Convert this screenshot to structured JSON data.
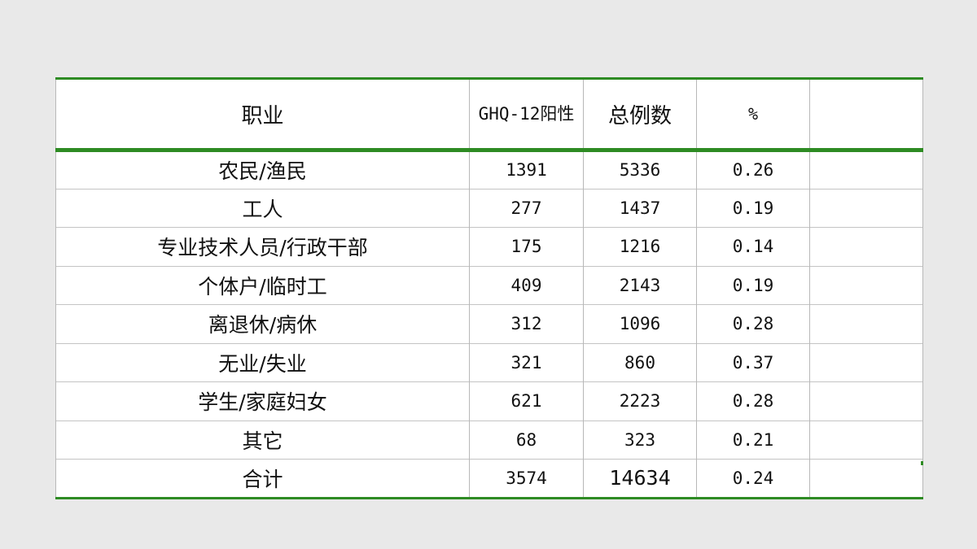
{
  "table": {
    "headers": {
      "occupation": "职业",
      "ghq_positive": "GHQ-12阳性",
      "total_cases": "总例数",
      "percent": "%",
      "extra": ""
    },
    "rows": [
      {
        "occupation": "农民/渔民",
        "ghq_positive": "1391",
        "total_cases": "5336",
        "percent": "0.26",
        "extra": ""
      },
      {
        "occupation": "工人",
        "ghq_positive": "277",
        "total_cases": "1437",
        "percent": "0.19",
        "extra": ""
      },
      {
        "occupation": "专业技术人员/行政干部",
        "ghq_positive": "175",
        "total_cases": "1216",
        "percent": "0.14",
        "extra": ""
      },
      {
        "occupation": "个体户/临时工",
        "ghq_positive": "409",
        "total_cases": "2143",
        "percent": "0.19",
        "extra": ""
      },
      {
        "occupation": "离退休/病休",
        "ghq_positive": "312",
        "total_cases": "1096",
        "percent": "0.28",
        "extra": ""
      },
      {
        "occupation": "无业/失业",
        "ghq_positive": "321",
        "total_cases": "860",
        "percent": "0.37",
        "extra": ""
      },
      {
        "occupation": "学生/家庭妇女",
        "ghq_positive": "621",
        "total_cases": "2223",
        "percent": "0.28",
        "extra": ""
      },
      {
        "occupation": "其它",
        "ghq_positive": "68",
        "total_cases": "323",
        "percent": "0.21",
        "extra": ""
      },
      {
        "occupation": "合计",
        "ghq_positive": "3574",
        "total_cases": "14634",
        "percent": "0.24",
        "extra": ""
      }
    ]
  },
  "colors": {
    "background": "#e9e9e9",
    "table_background": "#ffffff",
    "accent_green": "#2e8b23",
    "grid_line": "#b8b8b8"
  }
}
